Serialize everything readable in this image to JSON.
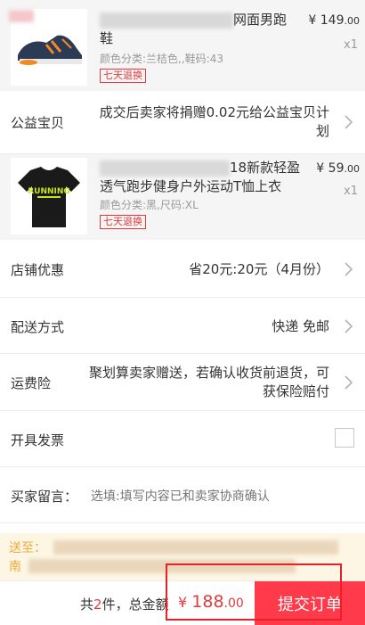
{
  "items": [
    {
      "title_visible": "网面男跑",
      "title_line2": "鞋",
      "price_symbol": "¥",
      "price_int": "149",
      "price_dec": ".00",
      "qty": "x1",
      "sku": "颜色分类:兰桔色,,鞋码:43",
      "tag": "七天退换",
      "thumb_icon": "shoe-image"
    },
    {
      "title_visible": "18新款轻盈",
      "title_line2": "透气跑步健身户外运动T恤上衣",
      "price_symbol": "¥",
      "price_int": "59",
      "price_dec": ".00",
      "qty": "x1",
      "sku": "颜色分类:黑,尺码:XL",
      "tag": "七天退换",
      "thumb_icon": "tshirt-image",
      "shirt_print": "RUNNING"
    }
  ],
  "charity": {
    "label": "公益宝贝",
    "line1": "成交后卖家将捐赠0.02元给公益宝贝计",
    "line2": "划"
  },
  "shop_discount": {
    "label": "店铺优惠",
    "value": "省20元:20元（4月份）"
  },
  "delivery": {
    "label": "配送方式",
    "value": "快递 免邮"
  },
  "shipping_insurance": {
    "label": "运费险",
    "line1": "聚划算卖家赠送，若确认收货前退货，可",
    "line2": "获保险赔付"
  },
  "invoice": {
    "label": "开具发票",
    "checked": false
  },
  "message": {
    "label": "买家留言：",
    "placeholder": "选填:填写内容已和卖家协商确认"
  },
  "address": {
    "line1_prefix": "送至：",
    "line2_prefix": "南"
  },
  "footer": {
    "count_prefix": "共",
    "count": "2",
    "count_suffix": "件，总金额",
    "total_symbol": "¥",
    "total_int": "188",
    "total_dec": ".00",
    "submit_label": "提交订单"
  },
  "colors": {
    "accent": "#ff3a4a",
    "price_red": "#e5393b",
    "highlight_frame": "#ee1d2a"
  }
}
